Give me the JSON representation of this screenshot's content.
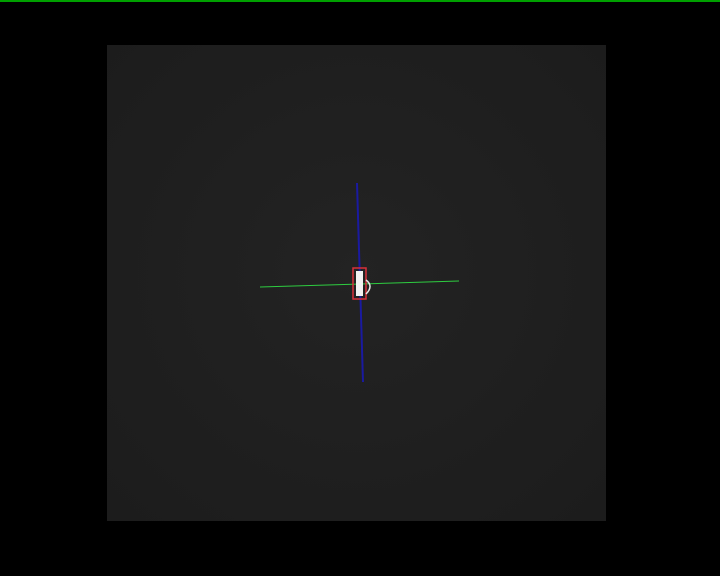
{
  "viewer": {
    "background_color": "#000000",
    "status_line_color": "#00a000",
    "frame_color": "#202020",
    "horizontal_axis_color": "#2ecc40",
    "vertical_axis_color": "#1a1aa0",
    "target_outline_color": "#d9303a",
    "target_fill_color": "#f2f2f2",
    "marker_icon": "crosshair-target-icon"
  }
}
